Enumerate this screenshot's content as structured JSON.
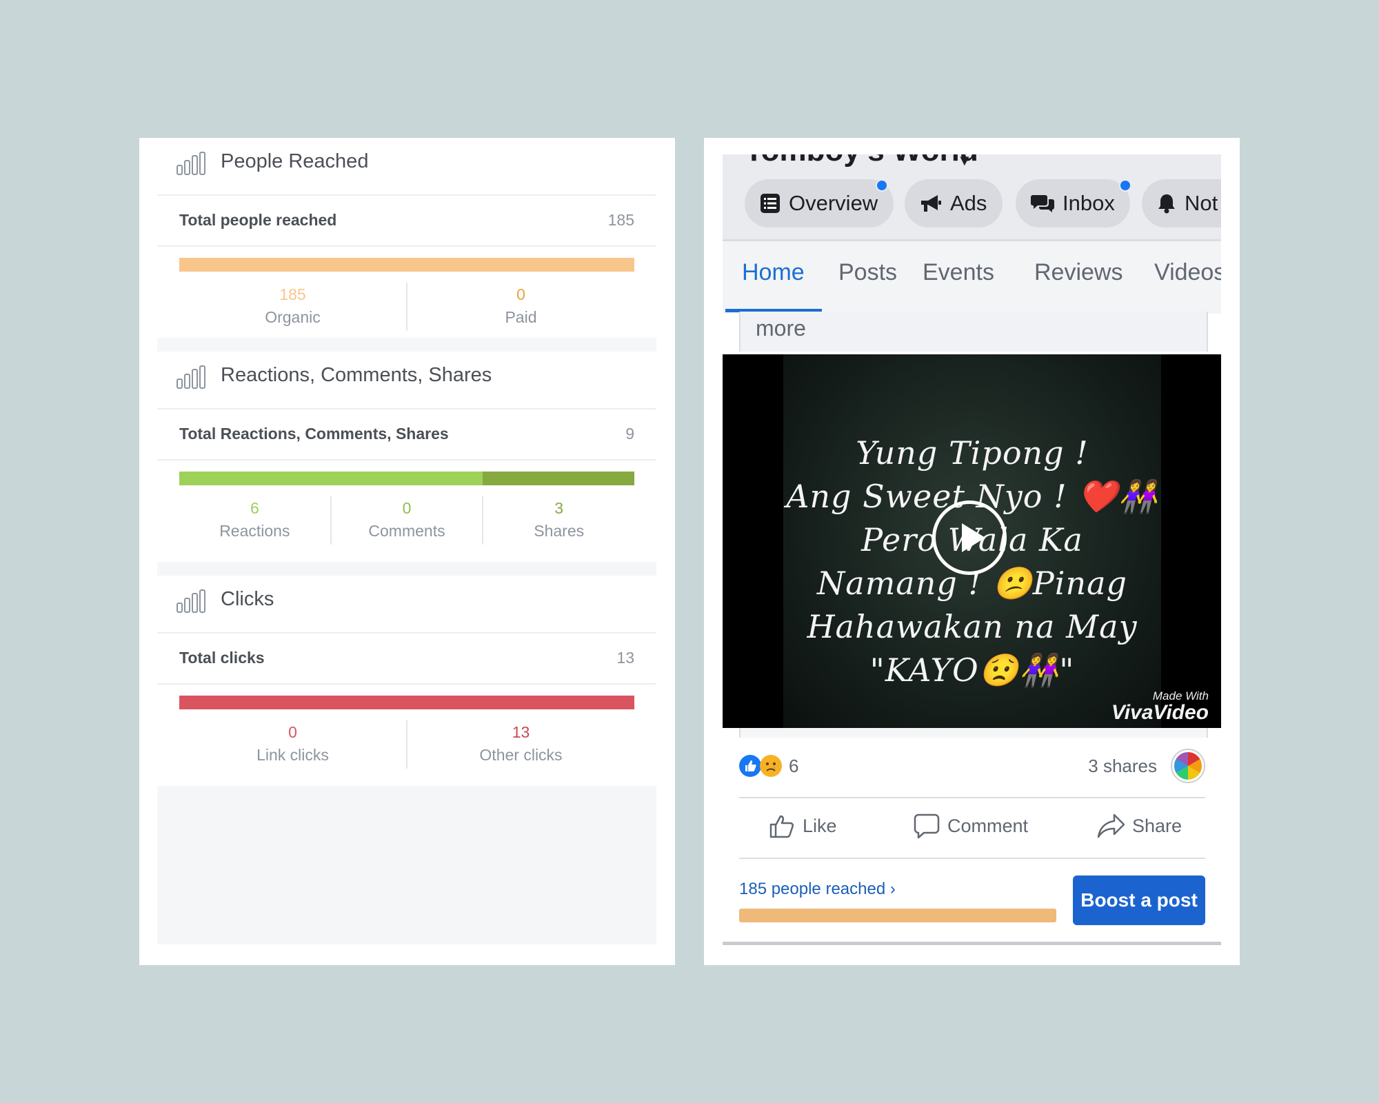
{
  "insights": {
    "sections": [
      {
        "title": "People Reached",
        "total_label": "Total people reached",
        "total_value": "185",
        "bar": [
          {
            "fraction": 1.0,
            "color": "#f8c68a"
          }
        ],
        "columns": [
          {
            "value": "185",
            "label": "Organic",
            "color": "#f8c68a"
          },
          {
            "value": "0",
            "label": "Paid",
            "color": "#e8a33a"
          }
        ]
      },
      {
        "title": "Reactions, Comments, Shares",
        "total_label": "Total Reactions, Comments, Shares",
        "total_value": "9",
        "bar": [
          {
            "fraction": 0.6667,
            "color": "#9dd157"
          },
          {
            "fraction": 0.3333,
            "color": "#86a940"
          }
        ],
        "columns": [
          {
            "value": "6",
            "label": "Reactions",
            "color": "#9dd157"
          },
          {
            "value": "0",
            "label": "Comments",
            "color": "#8fbf4e"
          },
          {
            "value": "3",
            "label": "Shares",
            "color": "#86a940"
          }
        ]
      },
      {
        "title": "Clicks",
        "total_label": "Total clicks",
        "total_value": "13",
        "bar": [
          {
            "fraction": 1.0,
            "color": "#d9545f"
          }
        ],
        "columns": [
          {
            "value": "0",
            "label": "Link clicks",
            "color": "#d9545f"
          },
          {
            "value": "13",
            "label": "Other clicks",
            "color": "#c94a52"
          }
        ]
      }
    ]
  },
  "facebook": {
    "page_name": "Tomboy's World",
    "pills": [
      {
        "label": "Overview",
        "icon": "list-icon",
        "dot": true
      },
      {
        "label": "Ads",
        "icon": "megaphone-icon",
        "dot": false
      },
      {
        "label": "Inbox",
        "icon": "chat-icon",
        "dot": true
      },
      {
        "label": "Not",
        "icon": "bell-icon",
        "dot": false
      }
    ],
    "tabs": [
      "Home",
      "Posts",
      "Events",
      "Reviews",
      "Videos"
    ],
    "active_tab": "Home",
    "more_label": "more",
    "video_lines": [
      "Yung Tipong !",
      "Ang Sweet Nyo ! ❤️👭",
      "Pero Wala Ka",
      "Namang ! 😕Pinag",
      "Hahawakan na May",
      "\"KAYO😟👭\""
    ],
    "watermark_top": "Made With",
    "watermark_main": "VivaVideo",
    "reaction_count": "6",
    "shares_text": "3 shares",
    "actions": {
      "like": "Like",
      "comment": "Comment",
      "share": "Share"
    },
    "reach_text": "185 people reached ›",
    "reach_fraction": 1.0,
    "boost_label": "Boost a post",
    "accent": "#1b64cf"
  }
}
